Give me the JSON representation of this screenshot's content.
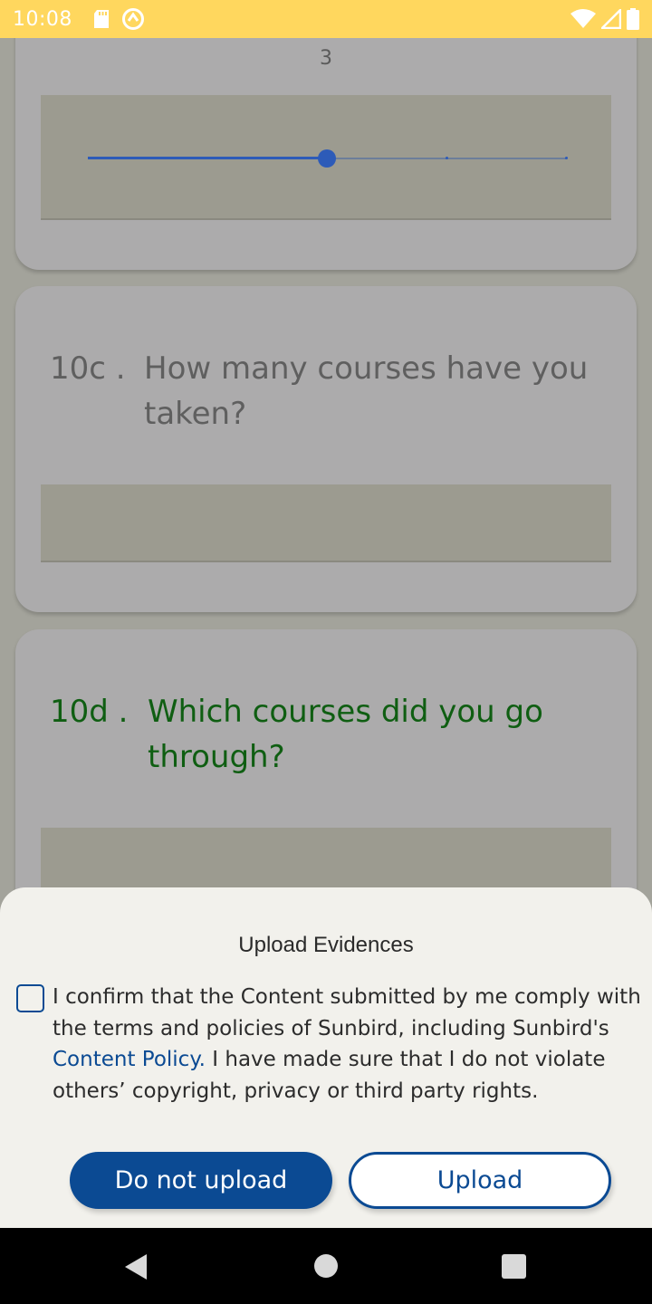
{
  "status_bar": {
    "time": "10:08",
    "icons_left": [
      "sd-card-icon",
      "sync-icon"
    ],
    "icons_right": [
      "wifi-icon",
      "signal-icon",
      "battery-icon"
    ]
  },
  "question_cards": [
    {
      "slider": {
        "value_label": "3",
        "min": 0,
        "max": 4,
        "value": 2,
        "ticks": [
          3,
          4
        ]
      }
    },
    {
      "number": "10c .",
      "text": "How many courses have you taken?"
    },
    {
      "number": "10d .",
      "text": "Which courses did you go through?"
    }
  ],
  "upload_sheet": {
    "title": "Upload Evidences",
    "consent_checked": false,
    "consent_prefix": "I confirm that the Content submitted by me comply with the terms and policies of Sunbird, including Sunbird's ",
    "consent_link": "Content Policy.",
    "consent_suffix": " I have made sure that I do not violate others’ copyright, privacy or third party rights.",
    "buttons": {
      "do_not_upload": "Do not upload",
      "upload": "Upload"
    }
  },
  "colors": {
    "status_bar": "#ffd75e",
    "primary": "#0b4a93",
    "slider": "#2d5bb8",
    "question_active": "#0f5e12",
    "sheet_bg": "#f2f1ec"
  },
  "nav_bar": {
    "icons": [
      "back-icon",
      "home-icon",
      "recents-icon"
    ]
  }
}
